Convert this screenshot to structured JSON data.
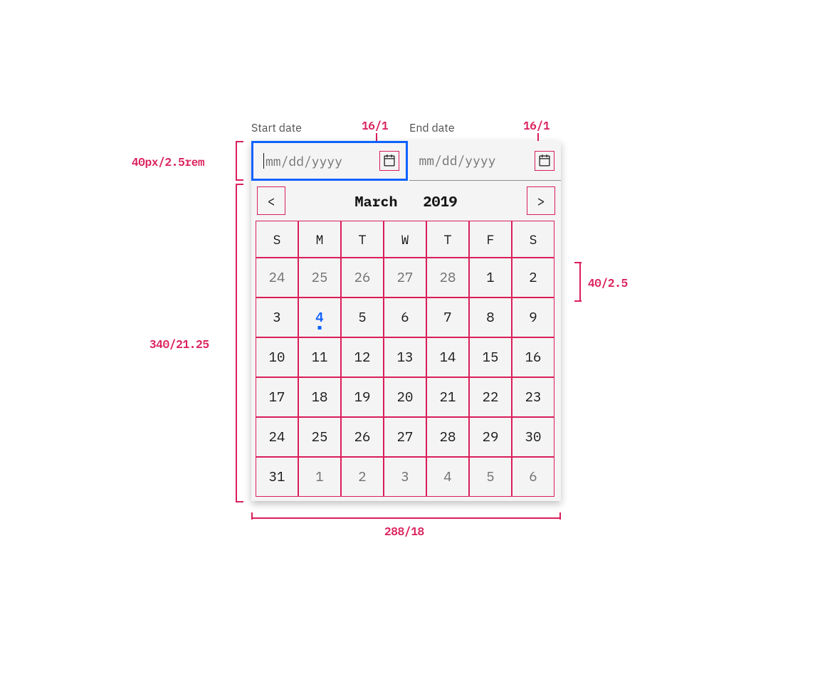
{
  "labels": {
    "start": "Start date",
    "end": "End date"
  },
  "inputs": {
    "start_placeholder": "mm/dd/yyyy",
    "end_placeholder": "mm/dd/yyyy"
  },
  "spec": {
    "icon_size": "16/1",
    "input_height": "40px/2.5rem",
    "panel_height": "340/21.25",
    "panel_width": "288/18",
    "row_height": "40/2.5"
  },
  "calendar": {
    "month_label": "March",
    "year_label": "2019",
    "prev_glyph": "<",
    "next_glyph": ">",
    "weekdays": [
      "S",
      "M",
      "T",
      "W",
      "T",
      "F",
      "S"
    ],
    "weeks": [
      [
        {
          "d": "24",
          "o": true
        },
        {
          "d": "25",
          "o": true
        },
        {
          "d": "26",
          "o": true
        },
        {
          "d": "27",
          "o": true
        },
        {
          "d": "28",
          "o": true
        },
        {
          "d": "1"
        },
        {
          "d": "2"
        }
      ],
      [
        {
          "d": "3"
        },
        {
          "d": "4",
          "today": true
        },
        {
          "d": "5"
        },
        {
          "d": "6"
        },
        {
          "d": "7"
        },
        {
          "d": "8"
        },
        {
          "d": "9"
        }
      ],
      [
        {
          "d": "10"
        },
        {
          "d": "11"
        },
        {
          "d": "12"
        },
        {
          "d": "13"
        },
        {
          "d": "14"
        },
        {
          "d": "15"
        },
        {
          "d": "16"
        }
      ],
      [
        {
          "d": "17"
        },
        {
          "d": "18"
        },
        {
          "d": "19"
        },
        {
          "d": "20"
        },
        {
          "d": "21"
        },
        {
          "d": "22"
        },
        {
          "d": "23"
        }
      ],
      [
        {
          "d": "24"
        },
        {
          "d": "25"
        },
        {
          "d": "26"
        },
        {
          "d": "27"
        },
        {
          "d": "28"
        },
        {
          "d": "29"
        },
        {
          "d": "30"
        }
      ],
      [
        {
          "d": "31"
        },
        {
          "d": "1",
          "o": true
        },
        {
          "d": "2",
          "o": true
        },
        {
          "d": "3",
          "o": true
        },
        {
          "d": "4",
          "o": true
        },
        {
          "d": "5",
          "o": true
        },
        {
          "d": "6",
          "o": true
        }
      ]
    ]
  },
  "colors": {
    "spec": "#da1e5a",
    "focus": "#0f62fe",
    "bg": "#f4f4f4",
    "text": "#161616",
    "muted": "#6f6f6f"
  }
}
